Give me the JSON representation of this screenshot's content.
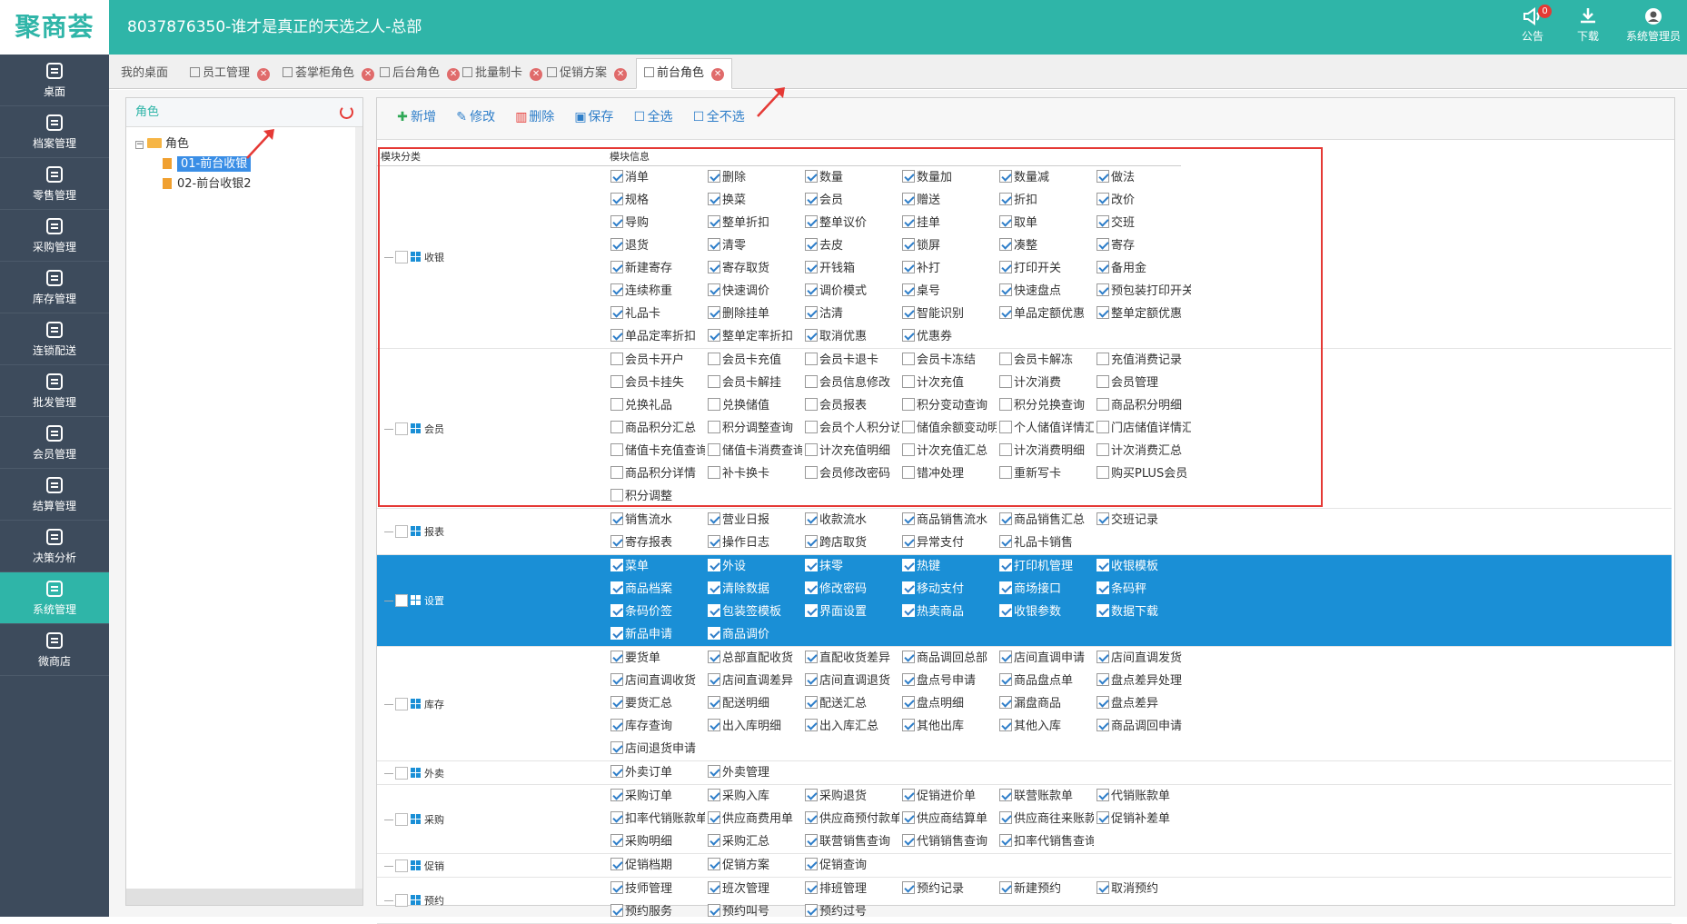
{
  "app": {
    "logo": "聚商荟",
    "title": "8037876350-谁才是真正的天选之人-总部",
    "actions": [
      {
        "label": "公告",
        "icon": "megaphone-icon",
        "badge": "0"
      },
      {
        "label": "下载",
        "icon": "download-icon"
      },
      {
        "label": "系统管理员",
        "icon": "user-avatar-icon"
      }
    ]
  },
  "sidebar": {
    "items": [
      {
        "label": "桌面",
        "icon": "dashboard-icon"
      },
      {
        "label": "档案管理",
        "icon": "archive-icon"
      },
      {
        "label": "零售管理",
        "icon": "store-icon"
      },
      {
        "label": "采购管理",
        "icon": "cart-icon"
      },
      {
        "label": "库存管理",
        "icon": "inventory-icon"
      },
      {
        "label": "连锁配送",
        "icon": "truck-icon"
      },
      {
        "label": "批发管理",
        "icon": "wholesale-icon"
      },
      {
        "label": "会员管理",
        "icon": "member-icon"
      },
      {
        "label": "结算管理",
        "icon": "yen-icon"
      },
      {
        "label": "决策分析",
        "icon": "chart-icon"
      },
      {
        "label": "系统管理",
        "icon": "gear-icon",
        "active": true
      },
      {
        "label": "微商店",
        "icon": "shop-bag-icon"
      }
    ]
  },
  "tabs": [
    {
      "label": "我的桌面"
    },
    {
      "label": "员工管理"
    },
    {
      "label": "荟掌柜角色"
    },
    {
      "label": "后台角色"
    },
    {
      "label": "批量制卡"
    },
    {
      "label": "促销方案"
    },
    {
      "label": "前台角色",
      "active": true
    }
  ],
  "left_panel": {
    "title": "角色",
    "root": "角色",
    "roles": [
      "01-前台收银",
      "02-前台收银2"
    ],
    "selected_role": "01-前台收银"
  },
  "toolbar": {
    "add": "新增",
    "edit": "修改",
    "delete": "删除",
    "save": "保存",
    "select_all": "全选",
    "deselect_all": "全不选"
  },
  "table": {
    "col_category": "模块分类",
    "col_info": "模块信息",
    "groups": [
      {
        "name": "收银",
        "checked": [
          1,
          1,
          1,
          1,
          1,
          1,
          1,
          1,
          1,
          1,
          1,
          1,
          1,
          1,
          1,
          1,
          1,
          1,
          1,
          1,
          1,
          1,
          1,
          1,
          1,
          1,
          1,
          1,
          1,
          1,
          1,
          1,
          1,
          1,
          1,
          1,
          1,
          1,
          1,
          1,
          1,
          1,
          1,
          1,
          1,
          1,
          1,
          1,
          1,
          1,
          1
        ],
        "items": [
          "消单",
          "删除",
          "数量",
          "数量加",
          "数量减",
          "做法",
          "规格",
          "换菜",
          "会员",
          "赠送",
          "折扣",
          "改价",
          "导购",
          "整单折扣",
          "整单议价",
          "挂单",
          "取单",
          "交班",
          "退货",
          "清零",
          "去皮",
          "锁屏",
          "凑整",
          "寄存",
          "新建寄存",
          "寄存取货",
          "开钱箱",
          "补打",
          "打印开关",
          "备用金",
          "连续称重",
          "快速调价",
          "调价模式",
          "桌号",
          "快速盘点",
          "预包装打印开关",
          "礼品卡",
          "删除挂单",
          "沽清",
          "智能识别",
          "单品定额优惠",
          "整单定额优惠",
          "单品定率折扣",
          "整单定率折扣",
          "取消优惠",
          "优惠券"
        ]
      },
      {
        "name": "会员",
        "checked": [
          0,
          0,
          0,
          0,
          0,
          0,
          0,
          0,
          0,
          0,
          0,
          0,
          0,
          0,
          0,
          0,
          0,
          0,
          0,
          0,
          0,
          0,
          0,
          0,
          0,
          0,
          0,
          0,
          0,
          0,
          0,
          0,
          0,
          0,
          0,
          0,
          0,
          0,
          0,
          0,
          0,
          0,
          0,
          0,
          0,
          0
        ],
        "items": [
          "会员卡开户",
          "会员卡充值",
          "会员卡退卡",
          "会员卡冻结",
          "会员卡解冻",
          "充值消费记录",
          "会员卡挂失",
          "会员卡解挂",
          "会员信息修改",
          "计次充值",
          "计次消费",
          "会员管理",
          "兑换礼品",
          "兑换储值",
          "会员报表",
          "积分变动查询",
          "积分兑换查询",
          "商品积分明细",
          "商品积分汇总",
          "积分调整查询",
          "会员个人积分访",
          "储值余额变动明",
          "个人储值详情汇",
          "门店储值详情汇总",
          "储值卡充值查询",
          "储值卡消费查询",
          "计次充值明细",
          "计次充值汇总",
          "计次消费明细",
          "计次消费汇总",
          "商品积分详情",
          "补卡换卡",
          "会员修改密码",
          "错冲处理",
          "重新写卡",
          "购买PLUS会员",
          "积分调整"
        ]
      },
      {
        "name": "报表",
        "checked": [
          1,
          1,
          1,
          1,
          1,
          1,
          1,
          1,
          1,
          1,
          1
        ],
        "items": [
          "销售流水",
          "营业日报",
          "收款流水",
          "商品销售流水",
          "商品销售汇总",
          "交班记录",
          "寄存报表",
          "操作日志",
          "跨店取货",
          "异常支付",
          "礼品卡销售"
        ]
      },
      {
        "name": "设置",
        "selected": true,
        "checked": [
          1,
          1,
          1,
          1,
          1,
          1,
          1,
          1,
          1,
          1,
          1,
          1,
          1,
          1,
          1,
          1,
          1,
          1,
          1,
          1
        ],
        "items": [
          "菜单",
          "外设",
          "抹零",
          "热键",
          "打印机管理",
          "收银模板",
          "商品档案",
          "清除数据",
          "修改密码",
          "移动支付",
          "商场接口",
          "条码秤",
          "条码价签",
          "包装签模板",
          "界面设置",
          "热卖商品",
          "收银参数",
          "数据下载",
          "新品申请",
          "商品调价"
        ]
      },
      {
        "name": "库存",
        "checked": [
          1,
          1,
          1,
          1,
          1,
          1,
          1,
          1,
          1,
          1,
          1,
          1,
          1,
          1,
          1,
          1,
          1,
          1,
          1,
          1,
          1,
          1,
          1,
          1,
          1,
          1,
          1,
          1
        ],
        "items": [
          "要货单",
          "总部直配收货",
          "直配收货差异",
          "商品调回总部",
          "店间直调申请",
          "店间直调发货",
          "店间直调收货",
          "店间直调差异",
          "店间直调退货",
          "盘点号申请",
          "商品盘点单",
          "盘点差异处理",
          "要货汇总",
          "配送明细",
          "配送汇总",
          "盘点明细",
          "漏盘商品",
          "盘点差异",
          "库存查询",
          "出入库明细",
          "出入库汇总",
          "其他出库",
          "其他入库",
          "商品调回申请",
          "店间退货申请"
        ]
      },
      {
        "name": "外卖",
        "checked": [
          1,
          1
        ],
        "items": [
          "外卖订单",
          "外卖管理"
        ]
      },
      {
        "name": "采购",
        "checked": [
          1,
          1,
          1,
          1,
          1,
          1,
          1,
          1,
          1,
          1,
          1,
          1,
          1,
          1,
          1,
          1,
          1,
          1,
          1,
          1,
          1
        ],
        "items": [
          "采购订单",
          "采购入库",
          "采购退货",
          "促销进价单",
          "联营账款单",
          "代销账款单",
          "扣率代销账款单",
          "供应商费用单",
          "供应商预付款单",
          "供应商结算单",
          "供应商往来账款",
          "促销补差单",
          "采购明细",
          "采购汇总",
          "联营销售查询",
          "代销销售查询",
          "扣率代销售查询"
        ]
      },
      {
        "name": "促销",
        "checked": [
          1,
          1,
          1
        ],
        "items": [
          "促销档期",
          "促销方案",
          "促销查询"
        ]
      },
      {
        "name": "预约",
        "checked": [
          1,
          1,
          1,
          1,
          1,
          1,
          1,
          1,
          1
        ],
        "items": [
          "技师管理",
          "班次管理",
          "排班管理",
          "预约记录",
          "新建预约",
          "取消预约",
          "预约服务",
          "预约叫号",
          "预约过号"
        ]
      }
    ]
  }
}
